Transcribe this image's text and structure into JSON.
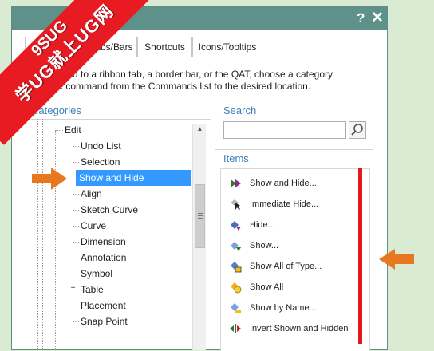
{
  "watermark": {
    "line1": "9SUG",
    "line2": "学UG就上UG网",
    "color": "#e81a22"
  },
  "titlebar": {
    "help": "?",
    "close": "✕",
    "color": "#5e9189"
  },
  "tabs": [
    {
      "label": "Tabs/Bars"
    },
    {
      "label": "Shortcuts"
    },
    {
      "label": "Icons/Tooltips"
    }
  ],
  "description": {
    "line1": "a command to a ribbon tab, a border bar, or the QAT, choose a category",
    "line2": "drag the command from the Commands list to the desired location."
  },
  "categories": {
    "title": "Categories",
    "items": [
      {
        "label": "Edit",
        "expander": "−"
      },
      {
        "label": "Undo List"
      },
      {
        "label": "Selection"
      },
      {
        "label": "Show and Hide",
        "selected": true
      },
      {
        "label": "Align"
      },
      {
        "label": "Sketch Curve"
      },
      {
        "label": "Curve"
      },
      {
        "label": "Dimension"
      },
      {
        "label": "Annotation"
      },
      {
        "label": "Symbol"
      },
      {
        "label": "Table",
        "expander": "+"
      },
      {
        "label": "Placement"
      },
      {
        "label": "Snap Point"
      }
    ]
  },
  "search": {
    "title": "Search",
    "value": "",
    "placeholder": ""
  },
  "items": {
    "title": "Items",
    "list": [
      {
        "label": "Show and Hide...",
        "icon": "show-and-hide-icon"
      },
      {
        "label": "Immediate Hide...",
        "icon": "immediate-hide-icon"
      },
      {
        "label": "Hide...",
        "icon": "hide-icon"
      },
      {
        "label": "Show...",
        "icon": "show-icon"
      },
      {
        "label": "Show All of Type...",
        "icon": "show-all-of-type-icon"
      },
      {
        "label": "Show All",
        "icon": "show-all-icon"
      },
      {
        "label": "Show by Name...",
        "icon": "show-by-name-icon"
      },
      {
        "label": "Invert Shown and Hidden",
        "icon": "invert-shown-hidden-icon"
      }
    ]
  },
  "annotations": {
    "arrow_color": "#e87722",
    "bar_color": "#e5191c"
  }
}
